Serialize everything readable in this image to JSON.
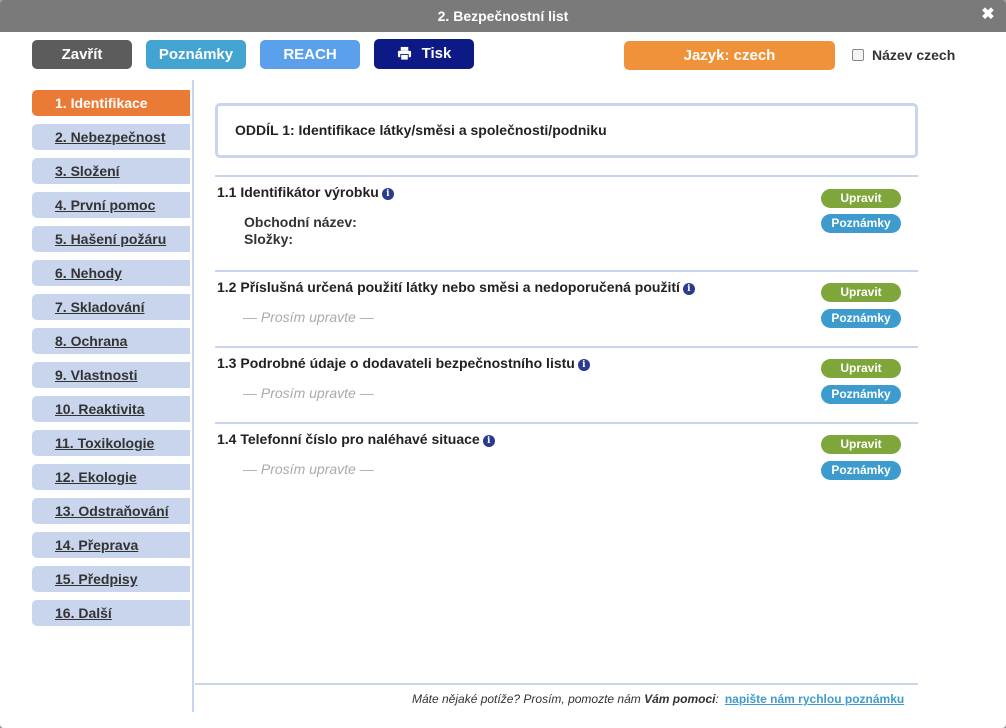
{
  "window": {
    "title": "2. Bezpečnostní list",
    "close_glyph": "✖"
  },
  "toolbar": {
    "close_label": "Zavřít",
    "notes_label": "Poznámky",
    "reach_label": "REACH",
    "print_label": "Tisk",
    "language_label": "Jazyk: czech",
    "name_checkbox_label": "Název czech",
    "name_checkbox_checked": false
  },
  "sidebar": {
    "items": [
      {
        "label": "1. Identifikace",
        "active": true
      },
      {
        "label": "2. Nebezpečnost"
      },
      {
        "label": "3. Složení"
      },
      {
        "label": "4. První pomoc"
      },
      {
        "label": "5. Hašení požáru"
      },
      {
        "label": "6. Nehody"
      },
      {
        "label": "7. Skladování"
      },
      {
        "label": "8. Ochrana"
      },
      {
        "label": "9. Vlastnosti"
      },
      {
        "label": "10. Reaktivita"
      },
      {
        "label": "11. Toxikologie"
      },
      {
        "label": "12. Ekologie"
      },
      {
        "label": "13. Odstraňování"
      },
      {
        "label": "14. Přeprava"
      },
      {
        "label": "15. Předpisy"
      },
      {
        "label": "16. Další"
      }
    ]
  },
  "main": {
    "section_title": "ODDÍL 1: Identifikace látky/směsi a společnosti/podniku",
    "edit_label": "Upravit",
    "notes_label": "Poznámky",
    "placeholder": "— Prosím upravte —",
    "subsections": [
      {
        "title": "1.1 Identifikátor výrobku",
        "fields": [
          "Obchodní název:",
          "Složky:"
        ]
      },
      {
        "title": "1.2 Příslušná určená použití látky nebo směsi a nedoporučená použití"
      },
      {
        "title": "1.3 Podrobné údaje o dodavateli bezpečnostního listu"
      },
      {
        "title": "1.4 Telefonní číslo pro naléhavé situace"
      }
    ]
  },
  "footer": {
    "question": "Máte nějaké potíže? Prosím, pomozte nám ",
    "bold": "Vám pomoci",
    "colon": ":",
    "link": "napište nám rychlou poznámku"
  },
  "colors": {
    "active_tab": "#ea7b36",
    "tab": "#c8d5ec",
    "edit": "#7ea63a",
    "notes": "#3d9ccd",
    "print": "#0d1a85",
    "language": "#f0923a"
  }
}
